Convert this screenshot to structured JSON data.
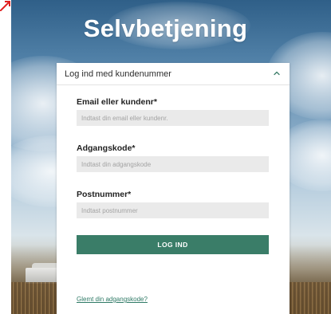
{
  "page": {
    "title": "Selvbetjening"
  },
  "login_card": {
    "header": "Log ind med kundenummer",
    "header_icon": "chevron-up-icon",
    "email": {
      "label": "Email eller kundenr*",
      "placeholder": "Indtast din email eller kundenr.",
      "value": ""
    },
    "password": {
      "label": "Adgangskode*",
      "placeholder": "Indtast din adgangskode",
      "value": ""
    },
    "postcode": {
      "label": "Postnummer*",
      "placeholder": "Indtast postnummer",
      "value": ""
    },
    "submit_label": "LOG IND",
    "forgot_link": "Glemt din adgangskode?"
  },
  "colors": {
    "accent": "#3a7d68",
    "title_text": "#ffffff",
    "input_bg": "#eaeaea"
  }
}
